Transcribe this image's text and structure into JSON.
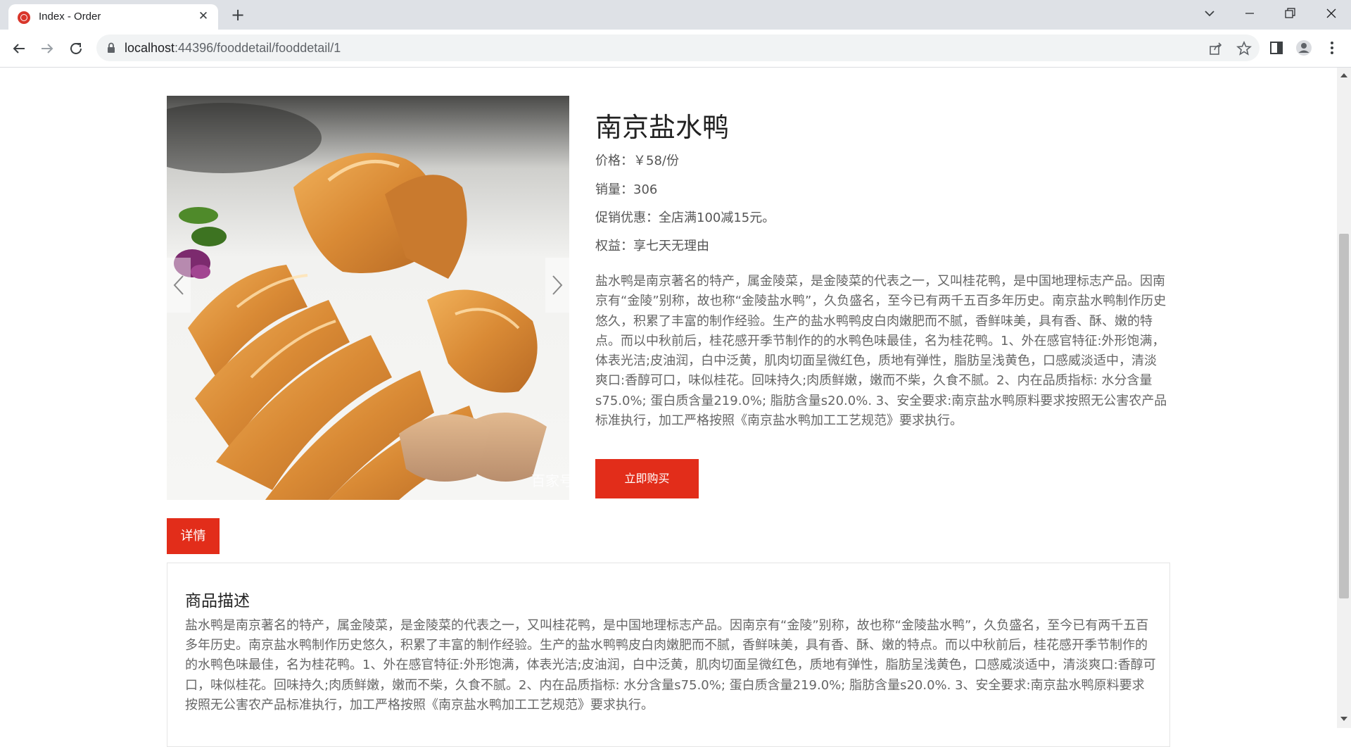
{
  "browser": {
    "tab_title": "Index - Order",
    "url_host": "localhost",
    "url_path": ":44396/fooddetail/fooddetail/1"
  },
  "product": {
    "name": "南京盐水鸭",
    "price_label": "价格：",
    "price_value": "￥58/份",
    "sales_label": "销量：",
    "sales_value": "306",
    "promo_label": "促销优惠：",
    "promo_value": "全店满100减15元。",
    "rights_label": "权益：",
    "rights_value": "享七天无理由",
    "description": "盐水鸭是南京著名的特产，属金陵菜，是金陵菜的代表之一，又叫桂花鸭，是中国地理标志产品。因南京有“金陵”别称，故也称“金陵盐水鸭”，久负盛名，至今已有两千五百多年历史。南京盐水鸭制作历史悠久，积累了丰富的制作经验。生产的盐水鸭鸭皮白肉嫩肥而不腻，香鲜味美，具有香、酥、嫩的特点。而以中秋前后，桂花感开季节制作的的水鸭色味最佳，名为桂花鸭。1、外在感官特征:外形饱满，体表光洁;皮油润，白中泛黄，肌肉切面呈微红色，质地有弹性，脂肪呈浅黄色，口感威淡适中，清淡爽口:香醇可口，味似桂花。回味持久;肉质鲜嫩，嫩而不柴，久食不腻。2、内在品质指标: 水分含量s75.0%; 蛋白质含量219.0%; 脂肪含量s20.0%. 3、安全要求:南京盐水鸭原料要求按照无公害农产品标准执行，加工严格按照《南京盐水鸭加工工艺规范》要求执行。",
    "image_watermark": "百家号"
  },
  "actions": {
    "buy_label": "立即购买",
    "detail_tab_label": "详情"
  },
  "detail_panel": {
    "title": "商品描述",
    "description": "盐水鸭是南京著名的特产，属金陵菜，是金陵菜的代表之一，又叫桂花鸭，是中国地理标志产品。因南京有“金陵”别称，故也称“金陵盐水鸭”，久负盛名，至今已有两千五百多年历史。南京盐水鸭制作历史悠久，积累了丰富的制作经验。生产的盐水鸭鸭皮白肉嫩肥而不腻，香鲜味美，具有香、酥、嫩的特点。而以中秋前后，桂花感开季节制作的的水鸭色味最佳，名为桂花鸭。1、外在感官特征:外形饱满，体表光洁;皮油润，白中泛黄，肌肉切面呈微红色，质地有弹性，脂肪呈浅黄色，口感威淡适中，清淡爽口:香醇可口，味似桂花。回味持久;肉质鲜嫩，嫩而不柴，久食不腻。2、内在品质指标: 水分含量s75.0%; 蛋白质含量219.0%; 脂肪含量s20.0%. 3、安全要求:南京盐水鸭原料要求按照无公害农产品标准执行，加工严格按照《南京盐水鸭加工工艺规范》要求执行。"
  },
  "colors": {
    "accent": "#e22d1a"
  }
}
